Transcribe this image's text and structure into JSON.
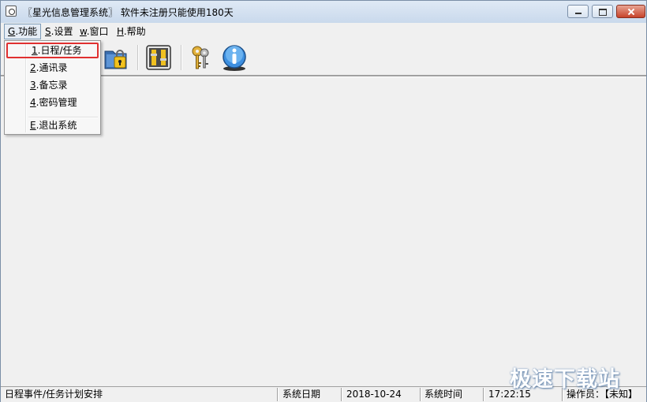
{
  "window": {
    "title": "〖星光信息管理系统〗 软件未注册只能使用180天"
  },
  "menubar": {
    "items": [
      {
        "hotkey": "G",
        "rest": ".功能"
      },
      {
        "hotkey": "S",
        "rest": ".设置"
      },
      {
        "hotkey": "w",
        "rest": ".窗口"
      },
      {
        "hotkey": "H",
        "rest": ".帮助"
      }
    ]
  },
  "dropdown": {
    "items": [
      {
        "hotkey": "1",
        "rest": ".日程/任务"
      },
      {
        "hotkey": "2",
        "rest": ".通讯录"
      },
      {
        "hotkey": "3",
        "rest": ".备忘录"
      },
      {
        "hotkey": "4",
        "rest": ".密码管理"
      },
      {
        "hotkey": "E",
        "rest": ".退出系统"
      }
    ]
  },
  "toolbar": {
    "icons": [
      "lock-folder-icon",
      "tools-settings-icon",
      "keys-icon",
      "info-icon"
    ]
  },
  "statusbar": {
    "description": "日程事件/任务计划安排",
    "date_label": "系统日期",
    "date_value": "2018-10-24",
    "time_label": "系统时间",
    "time_value": "17:22:15",
    "operator": "操作员：【未知】"
  },
  "watermark": "极速下载站"
}
